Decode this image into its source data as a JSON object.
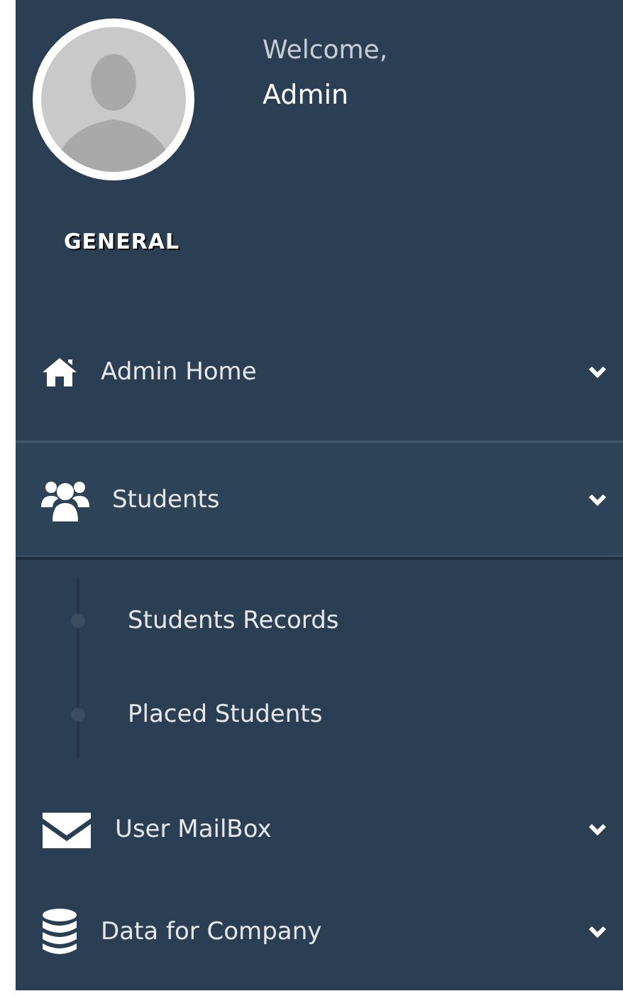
{
  "profile": {
    "greeting": "Welcome,",
    "name": "Admin"
  },
  "section_title": "GENERAL",
  "menu": [
    {
      "label": "Admin Home",
      "expanded": false
    },
    {
      "label": "Students",
      "expanded": true,
      "children": [
        {
          "label": "Students Records"
        },
        {
          "label": "Placed Students"
        }
      ]
    },
    {
      "label": "User MailBox",
      "expanded": false
    },
    {
      "label": "Data for Company",
      "expanded": false
    }
  ]
}
